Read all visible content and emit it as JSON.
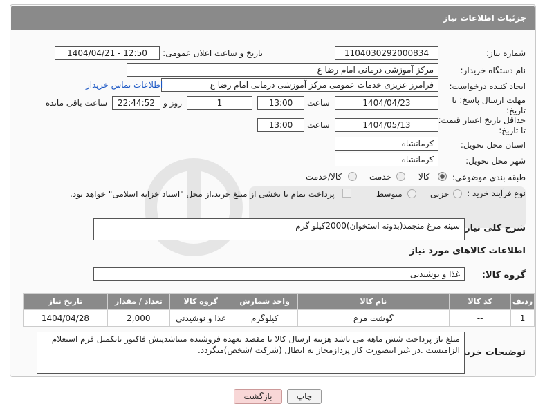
{
  "header": {
    "title": "جزئیات اطلاعات نیاز"
  },
  "fields": {
    "need_number_label": "شماره نیاز:",
    "need_number": "1104030292000834",
    "announce_label": "تاریخ و ساعت اعلان عمومی:",
    "announce_value": "1404/04/21 - 12:50",
    "buyer_org_label": "نام دستگاه خریدار:",
    "buyer_org": "مرکز آموزشی  درمانی امام رضا  ع",
    "requester_label": "ایجاد کننده درخواست:",
    "requester": "فرامرز عزیزی خدمات عمومی مرکز آموزشی  درمانی امام رضا  ع",
    "contact_link": "اطلاعات تماس خریدار",
    "deadline_label_1": "مهلت ارسال پاسخ: تا",
    "deadline_label_2": "تاریخ:",
    "deadline_date": "1404/04/23",
    "time_label": "ساعت",
    "deadline_time": "13:00",
    "days_value": "1",
    "days_label": "روز و",
    "remaining_time": "22:44:52",
    "remaining_label": "ساعت باقی مانده",
    "validity_label_1": "حداقل تاریخ اعتبار قیمت:",
    "validity_label_2": "تا تاریخ:",
    "validity_date": "1404/05/13",
    "validity_time": "13:00",
    "province_label": "استان محل تحویل:",
    "province": "کرمانشاه",
    "city_label": "شهر محل تحویل:",
    "city": "کرمانشاه",
    "category_label": "طبقه بندی موضوعی:",
    "category_options": [
      "کالا",
      "خدمت",
      "کالا/خدمت"
    ],
    "process_label": "نوع فرآیند خرید :",
    "process_options": [
      "جزیی",
      "متوسط"
    ],
    "payment_note": "پرداخت تمام یا بخشی از مبلغ خرید،از محل \"اسناد خزانه اسلامی\" خواهد بود."
  },
  "description": {
    "label": "شرح کلی نیاز:",
    "text": "سینه مرغ منجمد(بدونه استخوان)2000کیلو گرم"
  },
  "goods_section": {
    "title": "اطلاعات کالاهای مورد نیاز",
    "group_label": "گروه کالا:",
    "group_value": "غذا و نوشیدنی"
  },
  "table": {
    "headers": [
      "ردیف",
      "کد کالا",
      "نام کالا",
      "واحد شمارش",
      "گروه کالا",
      "تعداد / مقدار",
      "تاریخ نیاز"
    ],
    "rows": [
      [
        "1",
        "--",
        "گوشت مرغ",
        "کیلوگرم",
        "غذا و نوشیدنی",
        "2,000",
        "1404/04/28"
      ]
    ]
  },
  "buyer_notes": {
    "label": "توضیحات خریدار:",
    "line1": "مبلغ باز پرداخت شش ماهه می باشد هزینه ارسال کالا تا مقصد بعهده فروشنده میباشدپیش فاکتور یاتکمیل فرم استعلام",
    "line2": "الزامیست .در غیر اینصورت کار پردازمجاز به ابطال (شرکت /شخص)میگردد."
  },
  "buttons": {
    "print": "چاپ",
    "back": "بازگشت"
  },
  "colors": {
    "header_bg": "#8a8a8a",
    "link": "#1a56c4",
    "back_button_bg": "#f8d7d7"
  }
}
